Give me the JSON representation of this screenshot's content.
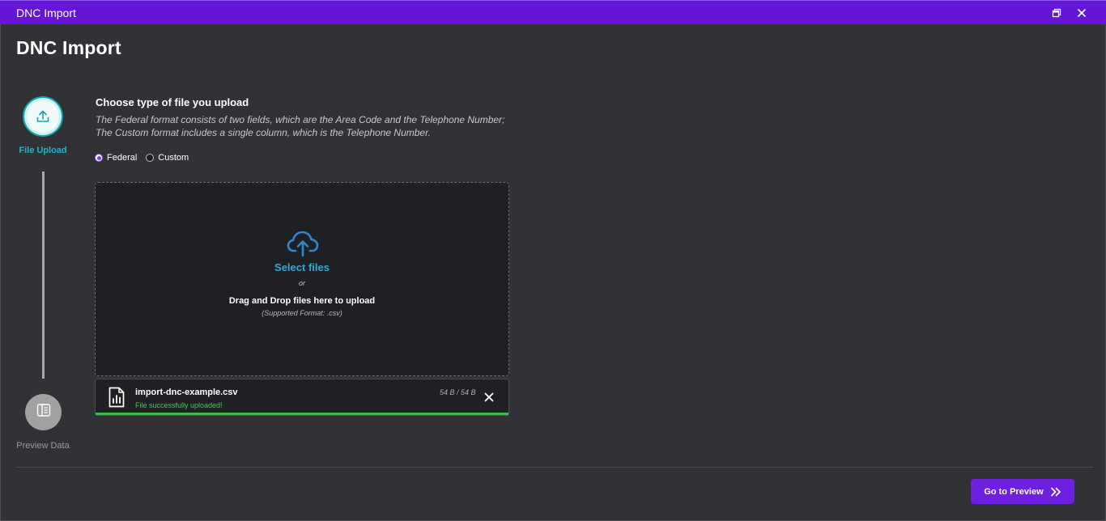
{
  "window": {
    "title": "DNC Import",
    "icons": [
      "restore-icon",
      "close-icon"
    ]
  },
  "page": {
    "title": "DNC Import"
  },
  "stepper": {
    "steps": [
      {
        "label": "File Upload",
        "icon": "upload-icon",
        "active": true
      },
      {
        "label": "Preview Data",
        "icon": "preview-data-icon",
        "active": false
      }
    ],
    "active_color": "#19b8c8",
    "inactive_color": "#a1a1a1"
  },
  "upload": {
    "section_title": "Choose type of file you upload",
    "description_line1": "The Federal format consists of two fields, which are the Area Code and the Telephone Number;",
    "description_line2": "The Custom format includes a single column, which is the Telephone Number.",
    "file_types": [
      {
        "label": "Federal",
        "selected": true
      },
      {
        "label": "Custom",
        "selected": false
      }
    ],
    "dropzone": {
      "icon": "cloud-upload-icon",
      "select_label": "Select files",
      "or_label": "or",
      "drag_label": "Drag and Drop files here to upload",
      "format_label": "(Supported Format: .csv)"
    },
    "file": {
      "icon": "file-chart-icon",
      "name": "import-dnc-example.csv",
      "size": "54 B / 54 B",
      "status": "File successfully uploaded!",
      "progress": 1.0
    }
  },
  "footer": {
    "next_button_label": "Go to Preview",
    "next_button_icon": "double-chevron-right-icon"
  },
  "colors": {
    "accent": "#6f1fe0",
    "titlebar": "#6415d6",
    "link": "#2eaad6",
    "success": "#3fcf4c",
    "background": "#323236"
  }
}
